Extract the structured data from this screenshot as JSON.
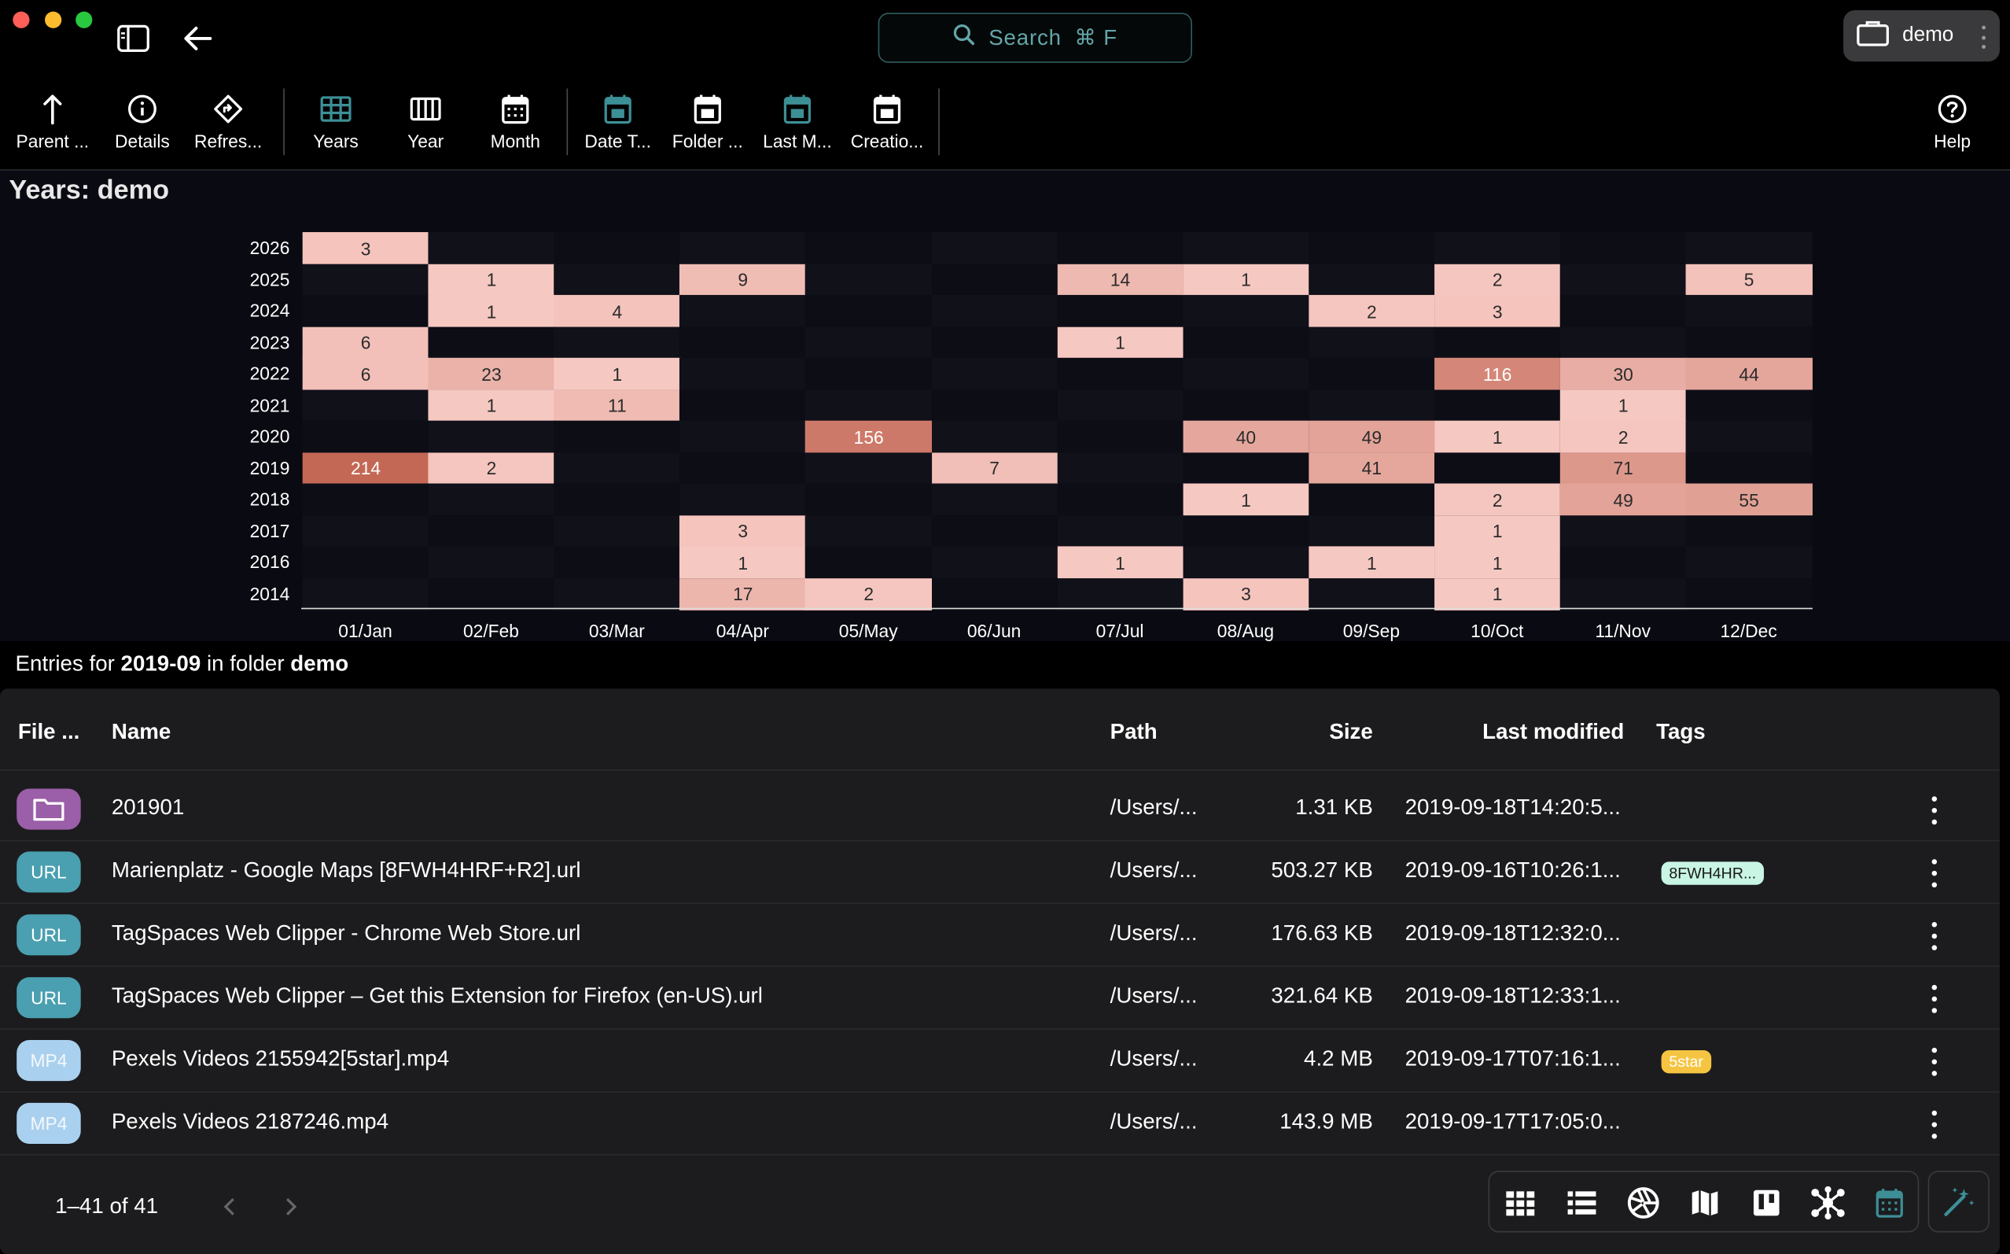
{
  "search": {
    "label": "Search",
    "shortcut": "⌘ F"
  },
  "location": {
    "name": "demo"
  },
  "toolbar": {
    "items": [
      {
        "label": "Parent ...",
        "icon": "arrow-up-icon"
      },
      {
        "label": "Details",
        "icon": "info-icon"
      },
      {
        "label": "Refres...",
        "icon": "refresh-icon"
      },
      {
        "label": "Years",
        "icon": "grid-icon"
      },
      {
        "label": "Year",
        "icon": "columns-icon"
      },
      {
        "label": "Month",
        "icon": "calendar-icon"
      },
      {
        "label": "Date T...",
        "icon": "calendar-icon"
      },
      {
        "label": "Folder ...",
        "icon": "calendar-icon"
      },
      {
        "label": "Last M...",
        "icon": "calendar-icon"
      },
      {
        "label": "Creatio...",
        "icon": "calendar-icon"
      }
    ],
    "help": "Help"
  },
  "heatmap_title": "Years: demo",
  "chart_data": {
    "type": "heatmap",
    "title": "Years: demo",
    "x_categories": [
      "01/Jan",
      "02/Feb",
      "03/Mar",
      "04/Apr",
      "05/May",
      "06/Jun",
      "07/Jul",
      "08/Aug",
      "09/Sep",
      "10/Oct",
      "11/Nov",
      "12/Dec"
    ],
    "y_categories": [
      "2026",
      "2025",
      "2024",
      "2023",
      "2022",
      "2021",
      "2020",
      "2019",
      "2018",
      "2017",
      "2016",
      "2014"
    ],
    "values": [
      [
        3,
        null,
        null,
        null,
        null,
        null,
        null,
        null,
        null,
        null,
        null,
        null
      ],
      [
        null,
        1,
        null,
        9,
        null,
        null,
        14,
        1,
        null,
        2,
        null,
        5
      ],
      [
        null,
        1,
        4,
        null,
        null,
        null,
        null,
        null,
        2,
        3,
        null,
        null
      ],
      [
        6,
        null,
        null,
        null,
        null,
        null,
        1,
        null,
        null,
        null,
        null,
        null
      ],
      [
        6,
        23,
        1,
        null,
        null,
        null,
        null,
        null,
        null,
        116,
        30,
        44
      ],
      [
        null,
        1,
        11,
        null,
        null,
        null,
        null,
        null,
        null,
        null,
        1,
        null
      ],
      [
        null,
        null,
        null,
        null,
        156,
        null,
        null,
        40,
        49,
        1,
        2,
        null
      ],
      [
        214,
        2,
        null,
        null,
        null,
        7,
        null,
        null,
        41,
        null,
        71,
        null
      ],
      [
        null,
        null,
        null,
        null,
        null,
        null,
        null,
        1,
        null,
        2,
        49,
        55
      ],
      [
        null,
        null,
        null,
        3,
        null,
        null,
        null,
        null,
        null,
        1,
        null,
        null
      ],
      [
        null,
        null,
        null,
        1,
        null,
        null,
        1,
        null,
        1,
        1,
        null,
        null
      ],
      [
        null,
        null,
        null,
        17,
        2,
        null,
        null,
        3,
        null,
        1,
        null,
        null
      ]
    ]
  },
  "entries": {
    "prefix": "Entries for ",
    "period": "2019-09",
    "middle": " in folder ",
    "folder": "demo"
  },
  "table": {
    "headers": [
      "File ...",
      "Name",
      "Path",
      "Size",
      "Last modified",
      "Tags"
    ],
    "rows": [
      {
        "type": "",
        "kind": "folder",
        "name": "201901",
        "path": "/Users/...",
        "size": "1.31 KB",
        "modified": "2019-09-18T14:20:5...",
        "tag": ""
      },
      {
        "type": "URL",
        "kind": "url",
        "name": "Marienplatz - Google Maps [8FWH4HRF+R2].url",
        "path": "/Users/...",
        "size": "503.27 KB",
        "modified": "2019-09-16T10:26:1...",
        "tag": "8FWH4HR..."
      },
      {
        "type": "URL",
        "kind": "url",
        "name": "TagSpaces Web Clipper - Chrome Web Store.url",
        "path": "/Users/...",
        "size": "176.63 KB",
        "modified": "2019-09-18T12:32:0...",
        "tag": ""
      },
      {
        "type": "URL",
        "kind": "url",
        "name": "TagSpaces Web Clipper – Get this Extension for Firefox (en-US).url",
        "path": "/Users/...",
        "size": "321.64 KB",
        "modified": "2019-09-18T12:33:1...",
        "tag": ""
      },
      {
        "type": "MP4",
        "kind": "mp4",
        "name": "Pexels Videos 2155942[5star].mp4",
        "path": "/Users/...",
        "size": "4.2 MB",
        "modified": "2019-09-17T07:16:1...",
        "tag": "5star"
      },
      {
        "type": "MP4",
        "kind": "mp4",
        "name": "Pexels Videos 2187246.mp4",
        "path": "/Users/...",
        "size": "143.9 MB",
        "modified": "2019-09-17T17:05:0...",
        "tag": ""
      }
    ]
  },
  "pagination": "1–41 of 41",
  "colors": {
    "folder": "#9b5ea8",
    "url": "#4a9fb0",
    "mp4": "#a9d0ee",
    "tag_geo": "#c8f5e4",
    "tag_star": "#f5c542",
    "accent": "#3d8f96"
  }
}
